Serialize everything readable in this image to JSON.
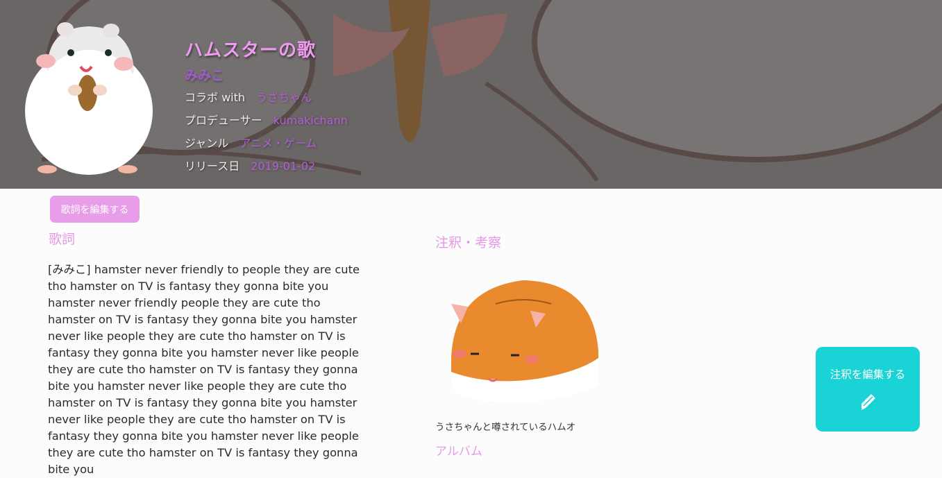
{
  "header": {
    "title": "ハムスターの歌",
    "artist": "みみこ",
    "rows": [
      {
        "label": "コラボ with",
        "value": "うさちゃん"
      },
      {
        "label": "プロデューサー",
        "value": "kumakichann"
      },
      {
        "label": "ジャンル",
        "value": "アニメ・ゲーム"
      },
      {
        "label": "リリース日",
        "value": "2019-01-02"
      }
    ]
  },
  "actions": {
    "edit_lyrics": "歌詞を編集する",
    "edit_notes": "注釈を編集する"
  },
  "lyrics": {
    "heading": "歌詞",
    "text": "[みみこ] hamster never friendly to people they are cute tho hamster on TV is fantasy they gonna bite you hamster never friendly people they are cute tho hamster on TV is fantasy they gonna bite you hamster never like people they are cute tho hamster on TV is fantasy they gonna bite you hamster never like people they are cute tho hamster on TV is fantasy they gonna bite you hamster never like people they are cute tho hamster on TV is fantasy they gonna bite you hamster never like people they are cute tho hamster on TV is fantasy they gonna bite you hamster never like people they are cute tho hamster on TV is fantasy they gonna bite you"
  },
  "notes": {
    "heading": "注釈・考察",
    "caption": "うさちゃんと噂されているハムオ",
    "album_heading": "アルバム"
  },
  "colors": {
    "accent_pink": "#e39ae6",
    "accent_purple": "#b35ed8",
    "teal_button": "#19d3d6"
  }
}
